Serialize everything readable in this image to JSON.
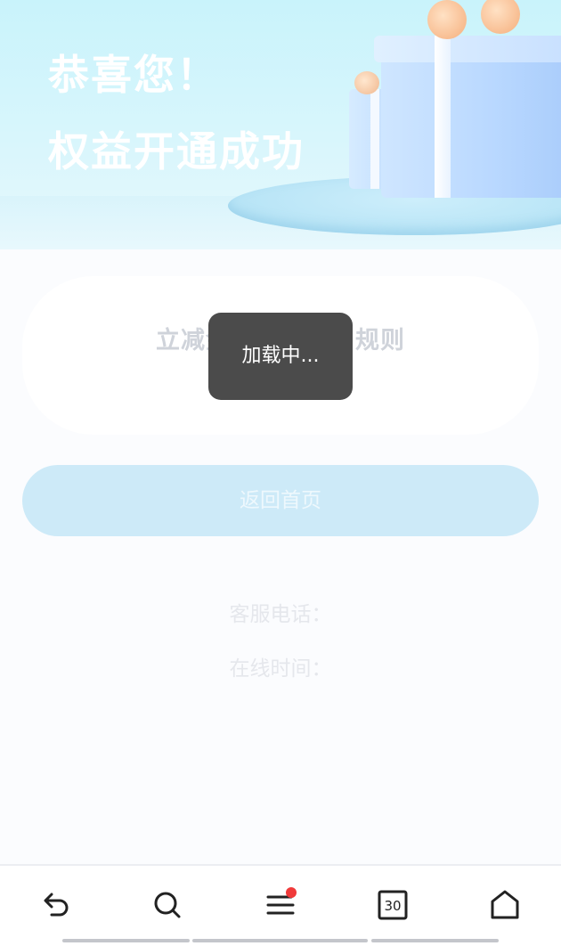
{
  "hero": {
    "line1": "恭喜您！",
    "line2": "权益开通成功"
  },
  "rules_card": {
    "title": "立减金领取及使用规则"
  },
  "home_button": {
    "label": "返回首页"
  },
  "service": {
    "phone_label": "客服电话：",
    "hours_label": "在线时间："
  },
  "toast": {
    "text": "加载中..."
  },
  "bottom_nav": {
    "items": [
      {
        "icon": "back-icon"
      },
      {
        "icon": "search-icon"
      },
      {
        "icon": "menu-icon",
        "has_badge": true
      },
      {
        "icon": "tabs-icon",
        "count": "30"
      },
      {
        "icon": "home-icon"
      }
    ]
  },
  "colors": {
    "accent": "#cdeaf8",
    "badge": "#f03a3a",
    "toast_bg": "#4b4b4b"
  }
}
